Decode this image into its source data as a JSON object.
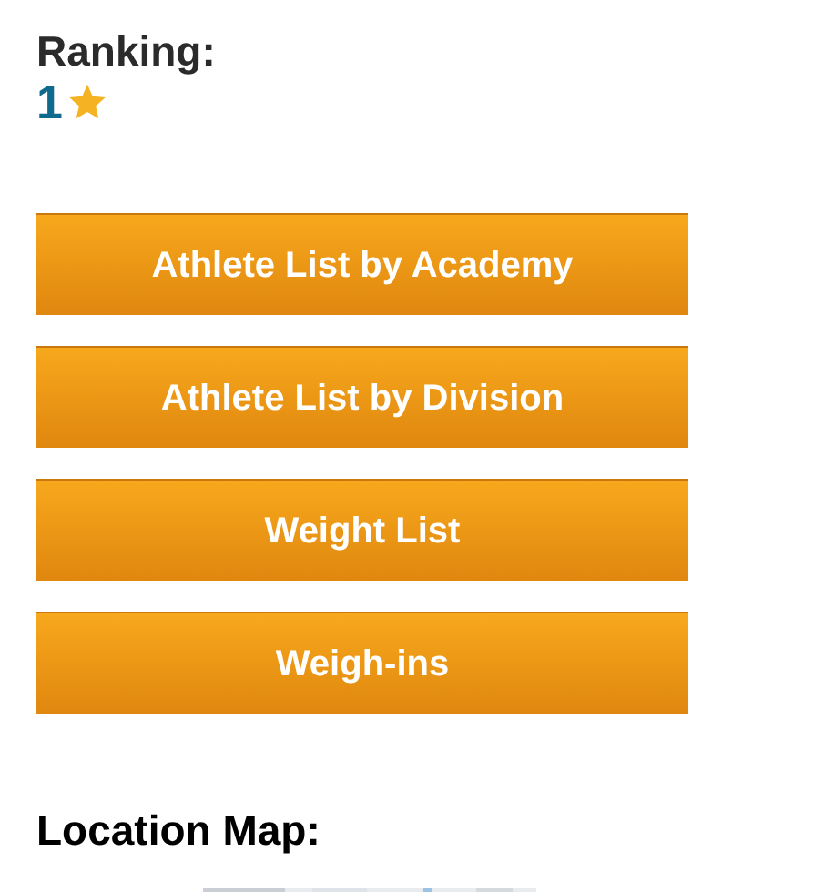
{
  "ranking": {
    "label": "Ranking:",
    "value": "1"
  },
  "buttons": [
    "Athlete List by Academy",
    "Athlete List by Division",
    "Weight List",
    "Weigh-ins"
  ],
  "location_map": {
    "heading": "Location Map:",
    "kind": "picture"
  }
}
